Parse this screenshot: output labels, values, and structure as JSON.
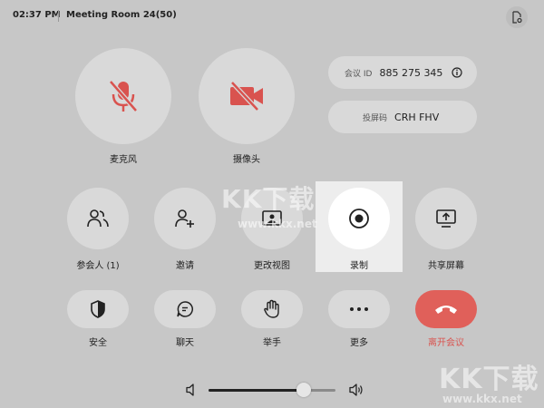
{
  "header": {
    "time": "02:37 PM",
    "room": "Meeting Room 24(50)"
  },
  "top_controls": [
    {
      "label": "麦克风",
      "icon": "mic-muted-icon"
    },
    {
      "label": "摄像头",
      "icon": "camera-off-icon"
    }
  ],
  "meeting_info": {
    "id_key": "会议 ID",
    "id_value": "885 275 345",
    "cast_key": "投屏码",
    "cast_value": "CRH FHV"
  },
  "mid_controls": [
    {
      "label": "参会人 (1)",
      "icon": "participants-icon"
    },
    {
      "label": "邀请",
      "icon": "invite-icon"
    },
    {
      "label": "更改视图",
      "icon": "change-view-icon"
    },
    {
      "label": "录制",
      "icon": "record-icon"
    },
    {
      "label": "共享屏幕",
      "icon": "share-screen-icon"
    }
  ],
  "bottom_controls": [
    {
      "label": "安全",
      "icon": "security-shield-icon"
    },
    {
      "label": "聊天",
      "icon": "chat-icon"
    },
    {
      "label": "举手",
      "icon": "raise-hand-icon"
    },
    {
      "label": "更多",
      "icon": "more-icon"
    },
    {
      "label": "离开会议",
      "icon": "leave-meeting-icon"
    }
  ],
  "volume": {
    "level": 0.75
  },
  "colors": {
    "background": "#c7c7c7",
    "button": "#d9d9d9",
    "muted_red": "#d9534f",
    "leave_red": "#e0605a"
  },
  "watermarks": {
    "brand": "KK下载",
    "url_center": "www.kkx.net",
    "url_corner": "www.kkx.net"
  }
}
